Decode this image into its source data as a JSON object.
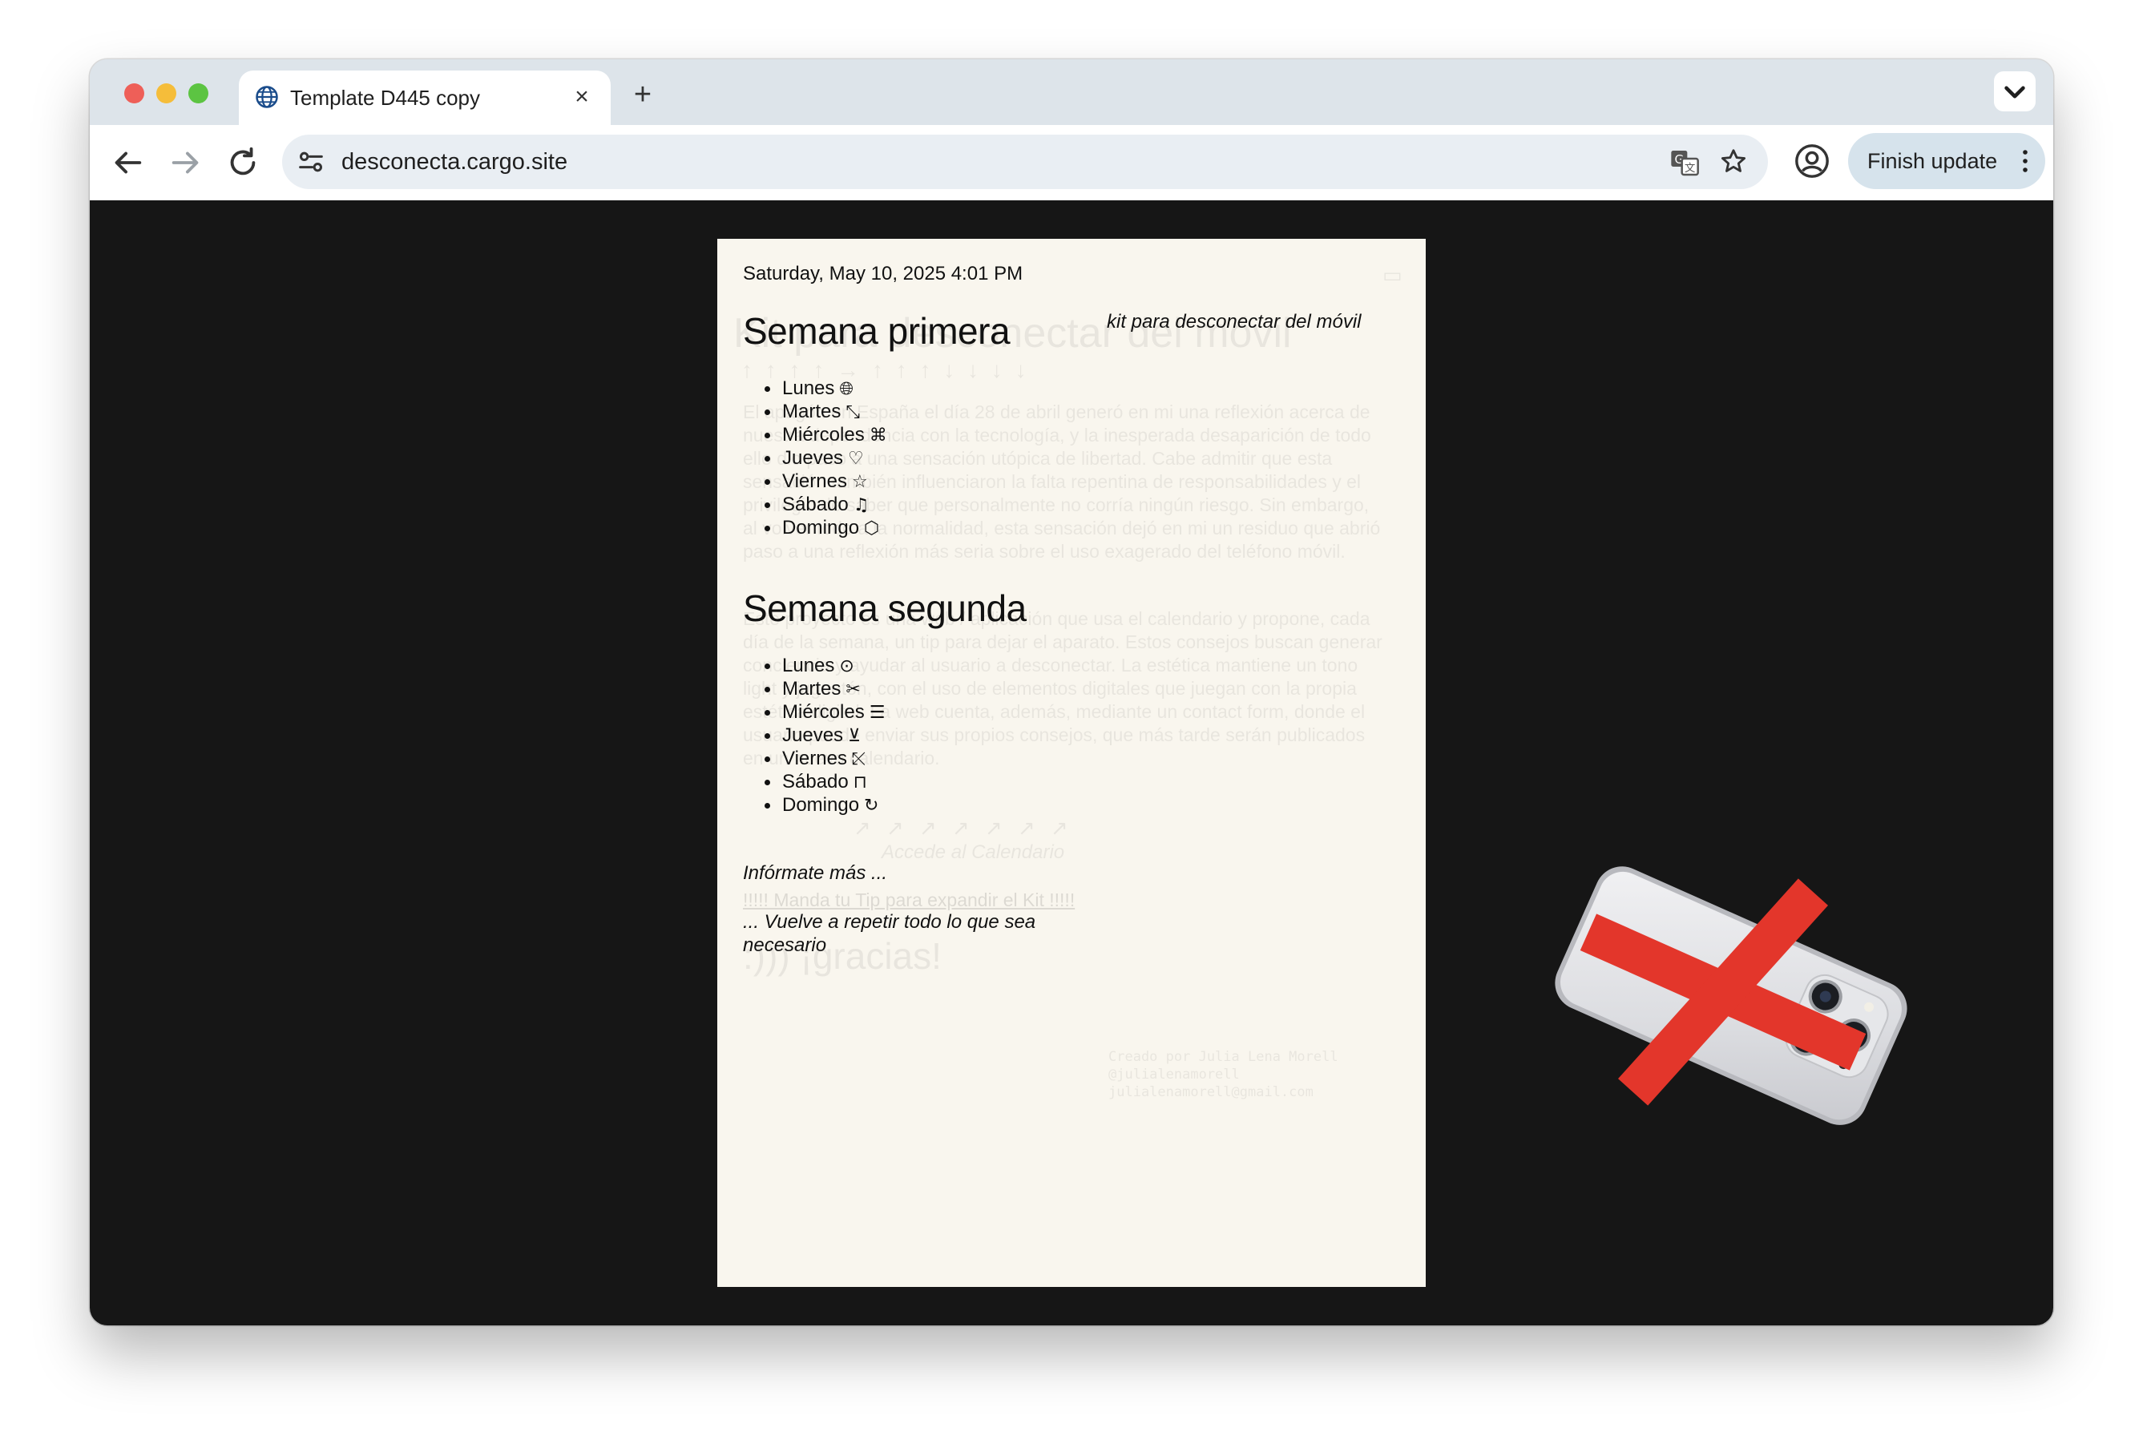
{
  "browser": {
    "tab_title": "Template D445 copy",
    "tab_close_glyph": "×",
    "new_tab_glyph": "+",
    "url": "desconecta.cargo.site",
    "finish_update_label": "Finish update",
    "icons": [
      "globe-icon",
      "close-icon",
      "plus-icon",
      "chevron-down-icon",
      "back-arrow-icon",
      "forward-arrow-icon",
      "reload-icon",
      "site-info-icon",
      "translate-icon",
      "star-icon",
      "profile-icon",
      "kebab-menu-icon"
    ]
  },
  "page": {
    "date_time": "Saturday, May 10, 2025 4:01 PM",
    "kit_label": "kit para desconectar del móvil",
    "weeks": [
      {
        "title": "Semana primera",
        "days": [
          {
            "label": "Lunes",
            "icon": "🌐︎"
          },
          {
            "label": "Martes",
            "icon": "⤡"
          },
          {
            "label": "Miércoles",
            "icon": "⌘"
          },
          {
            "label": "Jueves",
            "icon": "♡"
          },
          {
            "label": "Viernes",
            "icon": "☆"
          },
          {
            "label": "Sábado",
            "icon": "♫"
          },
          {
            "label": "Domingo",
            "icon": "⬡"
          }
        ]
      },
      {
        "title": "Semana segunda",
        "days": [
          {
            "label": "Lunes",
            "icon": "⊙"
          },
          {
            "label": "Martes",
            "icon": "✂"
          },
          {
            "label": "Miércoles",
            "icon": "☰"
          },
          {
            "label": "Jueves",
            "icon": "⊻"
          },
          {
            "label": "Viernes",
            "icon": "⤪"
          },
          {
            "label": "Sábado",
            "icon": "⊓"
          },
          {
            "label": "Domingo",
            "icon": "↻"
          }
        ]
      }
    ],
    "informate_label": "Infórmate más ...",
    "manda_link": "!!!!! Manda tu Tip para expandir el Kit !!!!!",
    "vuelve_label": "... Vuelve a repetir todo lo que sea necesario",
    "background": {
      "title": "Kit para desconectar del móvil",
      "arrows_row": "↑ ↑ ↑ ↑ → ↑ ↑ ↑ ↓ ↓ ↓ ↓",
      "paragraph_1": "El apagón en España el día 28 de abril generó en mi una reflexión acerca de nuestra dependencia con la tecnología, y la inesperada desaparición de todo ello dio paso a una sensación utópica de libertad. Cabe admitir que esta sensación también influenciaron la falta repentina de responsabilidades y el privilegio de saber que personalmente no corría ningún riesgo. Sin embargo, al volver todo a la normalidad, esta sensación dejó en mi un residuo que abrió paso a una reflexión más seria sobre el uso exagerado del teléfono móvil.",
      "paragraph_2": "Este proyecto es una web / aplicación que usa el calendario y propone, cada día de la semana, un tip para dejar el aparato. Estos consejos buscan generar conciencia y ayudar al usuario a desconectar. La estética mantiene un tono light y juguetón, con el uso de elementos digitales que juegan con la propia estética digital. La web cuenta, además, mediante un contact form, donde el usuario puede enviar sus propios consejos, que más tarde serán publicados en un nuevo calendario.",
      "arrows_row_2": "↗ ↗ ↗ ↗ ↗ ↗ ↗",
      "calendar_link": "Accede al Calendario",
      "gracias": ":))) ¡gracias!",
      "credits": [
        "Creado por Julia Lena Morell",
        "@julialenamorell",
        "julialenamorell@gmail.com"
      ]
    }
  },
  "colors": {
    "browser_chrome": "#dde4ea",
    "viewport_bg": "#161616",
    "page_bg": "#f9f6ee",
    "cross_red": "#e3362b"
  }
}
